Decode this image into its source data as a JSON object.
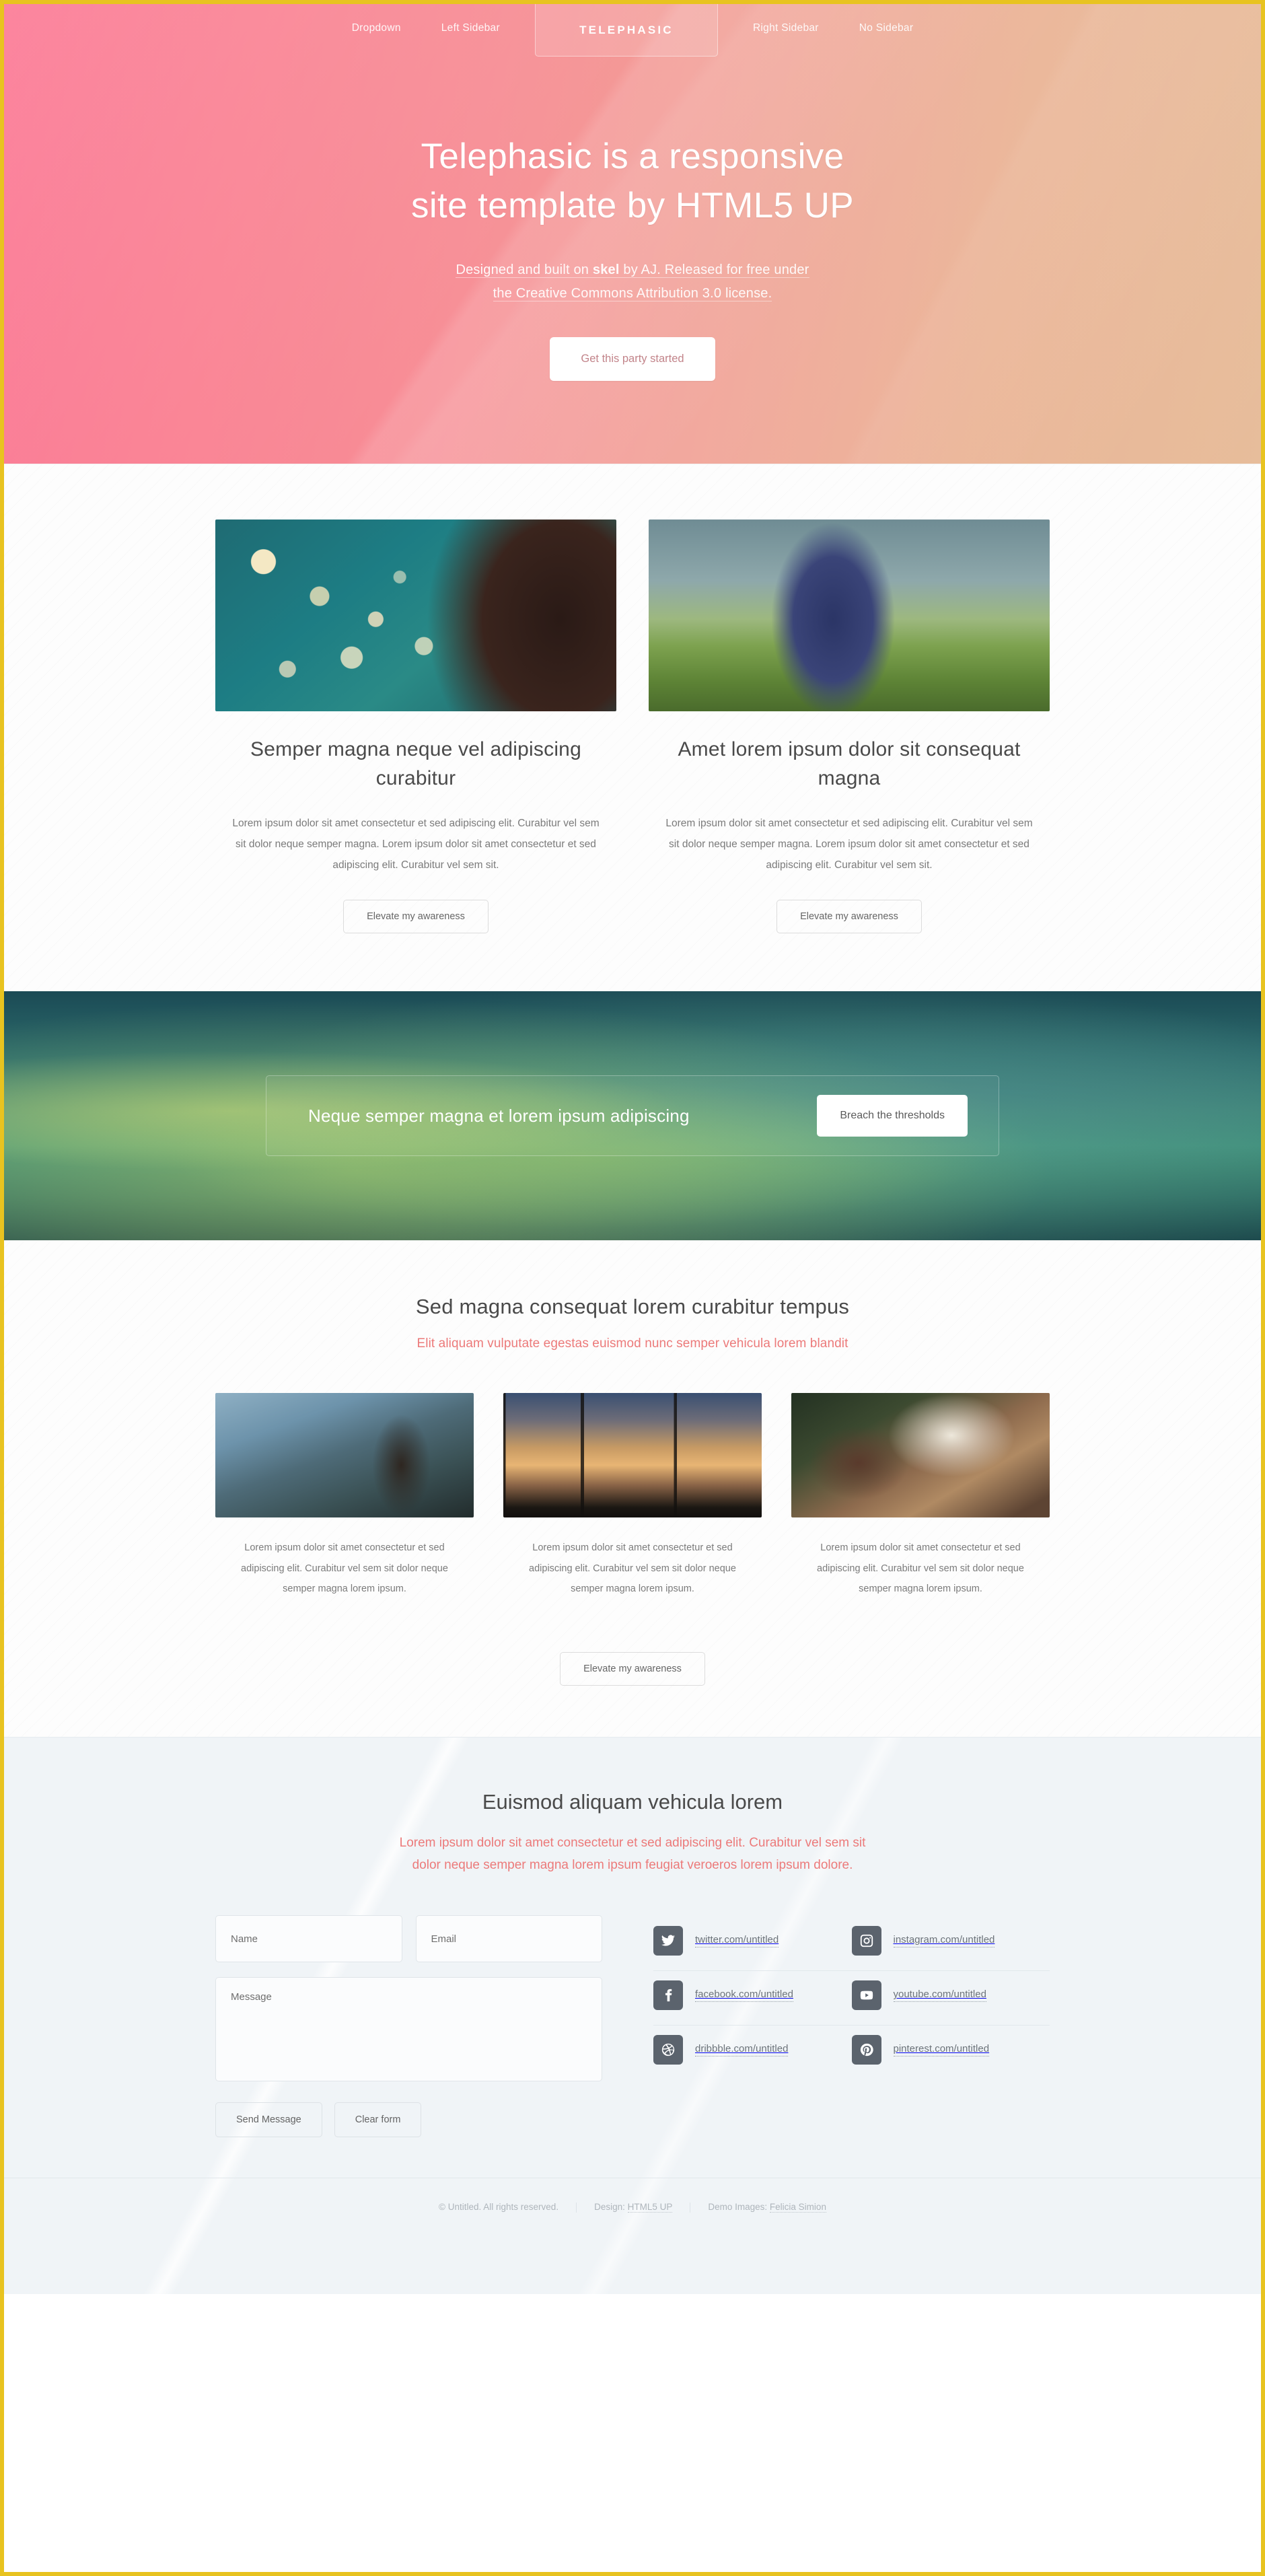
{
  "nav": {
    "logo": "TELEPHASIC",
    "left_items": [
      {
        "label": "Dropdown"
      },
      {
        "label": "Left Sidebar"
      }
    ],
    "right_items": [
      {
        "label": "Right Sidebar"
      },
      {
        "label": "No Sidebar"
      }
    ]
  },
  "hero": {
    "title_line1": "Telephasic is a responsive",
    "title_line2": "site template by HTML5 UP",
    "sub_pre": "Designed and built on ",
    "sub_brand": "skel",
    "sub_mid": " by AJ. Released for free under",
    "sub_line2": "the Creative Commons Attribution 3.0 license.",
    "cta_label": "Get this party started"
  },
  "features": {
    "columns": [
      {
        "image_name": "man-bokeh-photo",
        "heading": "Semper magna neque vel adipiscing curabitur",
        "body": "Lorem ipsum dolor sit amet consectetur et sed adipiscing elit. Curabitur vel sem sit dolor neque semper magna. Lorem ipsum dolor sit amet consectetur et sed adipiscing elit. Curabitur vel sem sit.",
        "button": "Elevate my awareness"
      },
      {
        "image_name": "woman-field-photo",
        "heading": "Amet lorem ipsum dolor sit consequat magna",
        "body": "Lorem ipsum dolor sit amet consectetur et sed adipiscing elit. Curabitur vel sem sit dolor neque semper magna. Lorem ipsum dolor sit amet consectetur et sed adipiscing elit. Curabitur vel sem sit.",
        "button": "Elevate my awareness"
      }
    ]
  },
  "banner": {
    "text": "Neque semper magna et lorem ipsum adipiscing",
    "button": "Breach the thresholds"
  },
  "showcase": {
    "heading": "Sed magna consequat lorem curabitur tempus",
    "subheading": "Elit aliquam vulputate egestas euismod nunc semper vehicula lorem blandit",
    "columns": [
      {
        "image_name": "train-platform-photo",
        "body": "Lorem ipsum dolor sit amet consectetur et sed adipiscing elit. Curabitur vel sem sit dolor neque semper magna lorem ipsum."
      },
      {
        "image_name": "wind-turbines-photo",
        "body": "Lorem ipsum dolor sit amet consectetur et sed adipiscing elit. Curabitur vel sem sit dolor neque semper magna lorem ipsum."
      },
      {
        "image_name": "woman-lace-photo",
        "body": "Lorem ipsum dolor sit amet consectetur et sed adipiscing elit. Curabitur vel sem sit dolor neque semper magna lorem ipsum."
      }
    ],
    "button": "Elevate my awareness"
  },
  "contact": {
    "heading": "Euismod aliquam vehicula lorem",
    "subheading_line1": "Lorem ipsum dolor sit amet consectetur et sed adipiscing elit. Curabitur vel sem sit",
    "subheading_line2": "dolor neque semper magna lorem ipsum feugiat veroeros lorem ipsum dolore.",
    "form": {
      "name_placeholder": "Name",
      "email_placeholder": "Email",
      "message_placeholder": "Message",
      "name_value": "",
      "email_value": "",
      "message_value": "",
      "send_label": "Send Message",
      "clear_label": "Clear form"
    },
    "social": [
      {
        "icon": "twitter-icon",
        "label": "twitter.com/untitled"
      },
      {
        "icon": "instagram-icon",
        "label": "instagram.com/untitled"
      },
      {
        "icon": "facebook-icon",
        "label": "facebook.com/untitled"
      },
      {
        "icon": "youtube-icon",
        "label": "youtube.com/untitled"
      },
      {
        "icon": "dribbble-icon",
        "label": "dribbble.com/untitled"
      },
      {
        "icon": "pinterest-icon",
        "label": "pinterest.com/untitled"
      }
    ]
  },
  "footer": {
    "copyright": "© Untitled. All rights reserved.",
    "design_prefix": "Design: ",
    "design_link": "HTML5 UP",
    "images_prefix": "Demo Images: ",
    "images_link": "Felicia Simion"
  },
  "colors": {
    "page_border": "#e8c320",
    "hero_pink": "#fb6e8c",
    "hero_peach": "#e7bd9b",
    "accent_red": "#ec7a7a",
    "banner_teal": "#3d8577",
    "social_icon_bg": "#5b636d",
    "contact_bg": "#f0f4f7"
  }
}
